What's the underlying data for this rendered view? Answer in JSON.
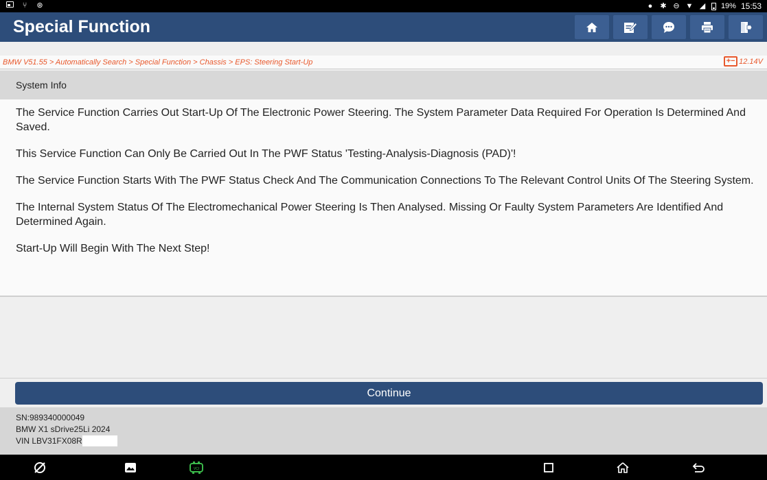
{
  "status_bar": {
    "left_icons": [
      "image-icon",
      "usb-icon",
      "settings-icon"
    ],
    "right_icons": [
      "location-icon",
      "bluetooth-icon",
      "dnd-icon",
      "wifi-icon",
      "signal-icon",
      "battery-icon"
    ],
    "battery_percent": "19%",
    "time": "15:53"
  },
  "header": {
    "title": "Special Function",
    "buttons": [
      {
        "name": "home",
        "icon": "home-icon"
      },
      {
        "name": "edit",
        "icon": "edit-icon"
      },
      {
        "name": "chat",
        "icon": "chat-icon"
      },
      {
        "name": "print",
        "icon": "print-icon"
      },
      {
        "name": "exit",
        "icon": "exit-icon"
      }
    ]
  },
  "breadcrumb": {
    "path": "BMW V51.55 > Automatically Search > Special Function > Chassis > EPS: Steering Start-Up",
    "voltage": "12.14V"
  },
  "section": {
    "title": "System Info"
  },
  "content": {
    "paragraphs": [
      " The Service Function Carries Out Start-Up Of The Electronic Power Steering. The System Parameter Data Required For Operation Is Determined And Saved.",
      "This Service Function Can Only Be Carried Out In The PWF Status 'Testing-Analysis-Diagnosis (PAD)'!",
      "The Service Function Starts With The PWF Status Check And The Communication Connections To The Relevant Control Units Of The Steering System.",
      "The Internal System Status Of The Electromechanical Power Steering Is Then Analysed. Missing Or Faulty System Parameters Are Identified And Determined Again.",
      "Start-Up Will Begin With The Next Step!"
    ]
  },
  "actions": {
    "continue_label": "Continue"
  },
  "device_info": {
    "sn": "SN:989340000049",
    "vehicle": "BMW X1 sDrive25Li 2024",
    "vin": "VIN LBV31FX08R"
  },
  "nav_bar": {
    "items": [
      "browser-icon",
      "gallery-icon",
      "vci-icon",
      "recent-apps-icon",
      "home-icon",
      "back-icon"
    ]
  },
  "colors": {
    "header_bg": "#2d4d7a",
    "button_bg": "#3c5f92",
    "accent_orange": "#e8582c",
    "vci_green": "#3bb84a"
  }
}
